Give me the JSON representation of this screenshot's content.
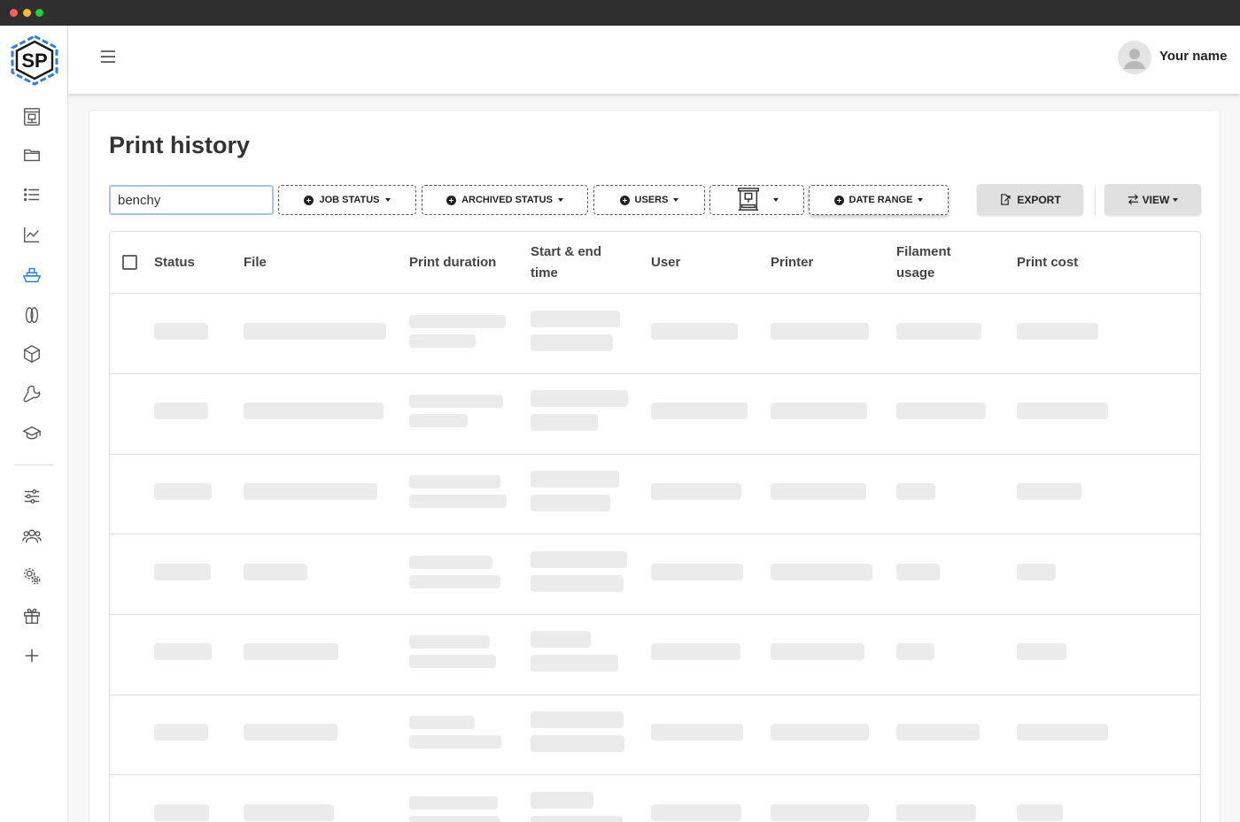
{
  "window": {
    "controls": [
      "close",
      "minimize",
      "maximize"
    ]
  },
  "logo": {
    "text": "SP"
  },
  "sidebar": {
    "items": [
      {
        "icon": "printer-icon"
      },
      {
        "icon": "folder-icon"
      },
      {
        "icon": "list-icon"
      },
      {
        "icon": "chart-line-icon"
      },
      {
        "icon": "benchy-boat-icon",
        "active": true
      },
      {
        "icon": "filament-spool-icon"
      },
      {
        "icon": "cube-icon"
      },
      {
        "icon": "wrench-icon"
      },
      {
        "icon": "graduation-cap-icon"
      },
      {
        "icon": "sliders-icon"
      },
      {
        "icon": "users-icon"
      },
      {
        "icon": "gears-icon"
      },
      {
        "icon": "gift-icon"
      },
      {
        "icon": "plus-icon"
      }
    ]
  },
  "header": {
    "menu_icon": "hamburger-menu-icon",
    "user_name": "Your name"
  },
  "page": {
    "title": "Print history"
  },
  "filters": {
    "search_value": "benchy",
    "job_status": "JOB STATUS",
    "archived_status": "ARCHIVED STATUS",
    "users": "USERS",
    "printer_icon": "printer-icon",
    "date_range": "DATE RANGE"
  },
  "actions": {
    "export": "EXPORT",
    "view": "VIEW"
  },
  "table": {
    "columns": {
      "status": "Status",
      "file": "File",
      "print_duration": "Print duration",
      "start_end_time": "Start & end time",
      "user": "User",
      "printer": "Printer",
      "filament_usage": "Filament usage",
      "print_cost": "Print cost"
    },
    "rows": [
      {
        "state": "loading"
      },
      {
        "state": "loading"
      },
      {
        "state": "loading"
      },
      {
        "state": "loading"
      },
      {
        "state": "loading"
      },
      {
        "state": "loading"
      },
      {
        "state": "loading"
      }
    ]
  },
  "colors": {
    "accent": "#2f80d6",
    "skeleton": "#ebebeb",
    "topbar": "#ffffff",
    "titlebar": "#2f2f2f"
  }
}
